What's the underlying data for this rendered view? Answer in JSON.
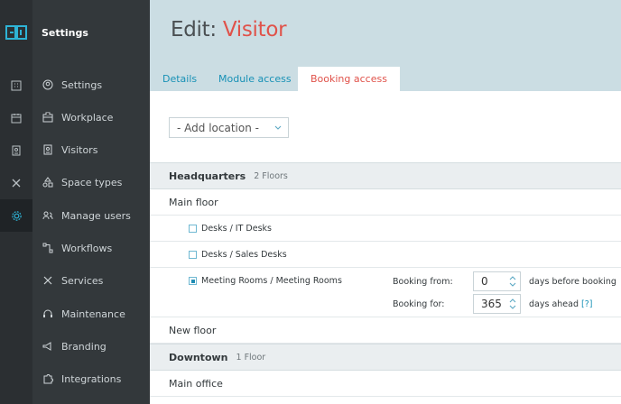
{
  "sidebar": {
    "title": "Settings",
    "items": [
      {
        "label": "Settings",
        "icon": "user-circle-icon"
      },
      {
        "label": "Workplace",
        "icon": "briefcase-icon"
      },
      {
        "label": "Visitors",
        "icon": "visitor-badge-icon"
      },
      {
        "label": "Space types",
        "icon": "shapes-icon"
      },
      {
        "label": "Manage users",
        "icon": "users-icon"
      },
      {
        "label": "Workflows",
        "icon": "workflow-icon"
      },
      {
        "label": "Services",
        "icon": "tools-icon"
      },
      {
        "label": "Maintenance",
        "icon": "headset-icon"
      },
      {
        "label": "Branding",
        "icon": "megaphone-icon"
      },
      {
        "label": "Integrations",
        "icon": "puzzle-icon"
      }
    ]
  },
  "header": {
    "title_prefix": "Edit:",
    "title_name": "Visitor"
  },
  "tabs": [
    {
      "label": "Details",
      "active": false
    },
    {
      "label": "Module access",
      "active": false
    },
    {
      "label": "Booking access",
      "active": true
    }
  ],
  "add_location": {
    "label": "- Add location -"
  },
  "locations": [
    {
      "name": "Headquarters",
      "floors_count": "2 Floors",
      "floors": [
        {
          "name": "Main floor",
          "resources": [
            {
              "label": "Desks / IT Desks",
              "checked": false
            },
            {
              "label": "Desks / Sales Desks",
              "checked": false
            },
            {
              "label": "Meeting Rooms / Meeting Rooms",
              "checked": true,
              "booking_from_label": "Booking from:",
              "booking_from_value": "0",
              "booking_from_suffix": "days before booking",
              "booking_for_label": "Booking for:",
              "booking_for_value": "365",
              "booking_for_suffix": "days ahead",
              "help": "[?]"
            }
          ]
        },
        {
          "name": "New floor",
          "resources": []
        }
      ]
    },
    {
      "name": "Downtown",
      "floors_count": "1 Floor",
      "floors": [
        {
          "name": "Main office",
          "resources": []
        }
      ]
    }
  ],
  "colors": {
    "accent_red": "#e0524a",
    "link_blue": "#1891b6",
    "header_bg": "#cbdde3",
    "sidebar_bg": "#33383b"
  }
}
